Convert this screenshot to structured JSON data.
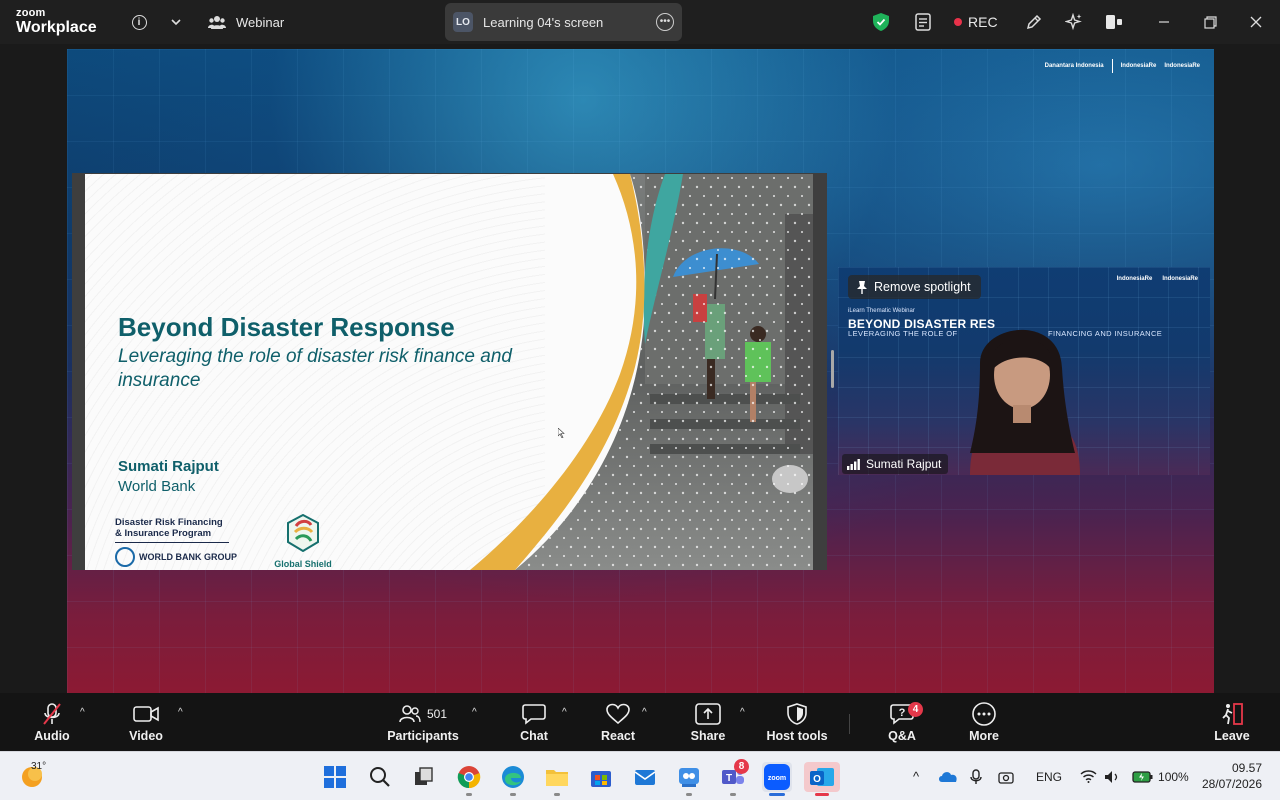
{
  "app": {
    "brand_top": "zoom",
    "brand_bottom": "Workplace"
  },
  "titlebar": {
    "meeting_type": "Webinar",
    "screen_share": {
      "initials": "LO",
      "label": "Learning 04's screen"
    },
    "recording_label": "REC"
  },
  "background": {
    "logo_left": "Danantara Indonesia",
    "logo_mid": "IndonesiaRe",
    "logo_right": "IndonesiaRe"
  },
  "slide": {
    "title": "Beyond Disaster Response",
    "subtitle": "Leveraging the role of disaster risk finance and insurance",
    "presenter_name": "Sumati Rajput",
    "presenter_org": "World Bank",
    "program_line1": "Disaster Risk Financing",
    "program_line2": "& Insurance Program",
    "wbg_label": "WORLD BANK GROUP",
    "gs_label": "Global Shield"
  },
  "spotlight": {
    "remove_label": "Remove spotlight",
    "name": "Sumati Rajput",
    "webinar_small": "iLearn Thematic Webinar",
    "webinar_title": "BEYOND DISASTER RES",
    "webinar_sub": "LEVERAGING THE ROLE OF",
    "webinar_sub2": "FINANCING AND INSURANCE",
    "logo_left": "IndonesiaRe",
    "logo_right": "IndonesiaRe"
  },
  "toolbar": {
    "audio": "Audio",
    "video": "Video",
    "participants": "Participants",
    "participants_count": "501",
    "chat": "Chat",
    "react": "React",
    "share": "Share",
    "host_tools": "Host tools",
    "qa": "Q&A",
    "qa_badge": "4",
    "more": "More",
    "leave": "Leave"
  },
  "taskbar": {
    "temperature": "31°",
    "teams_badge": "8",
    "language": "ENG",
    "battery": "100%",
    "time": "09.57",
    "date": "28/07/2026"
  },
  "colors": {
    "accent_green": "#1fb35a",
    "rec_red": "#e8324a",
    "badge_red": "#e5384a",
    "slide_teal": "#0f5f6a",
    "slide_gold": "#e8b040"
  }
}
